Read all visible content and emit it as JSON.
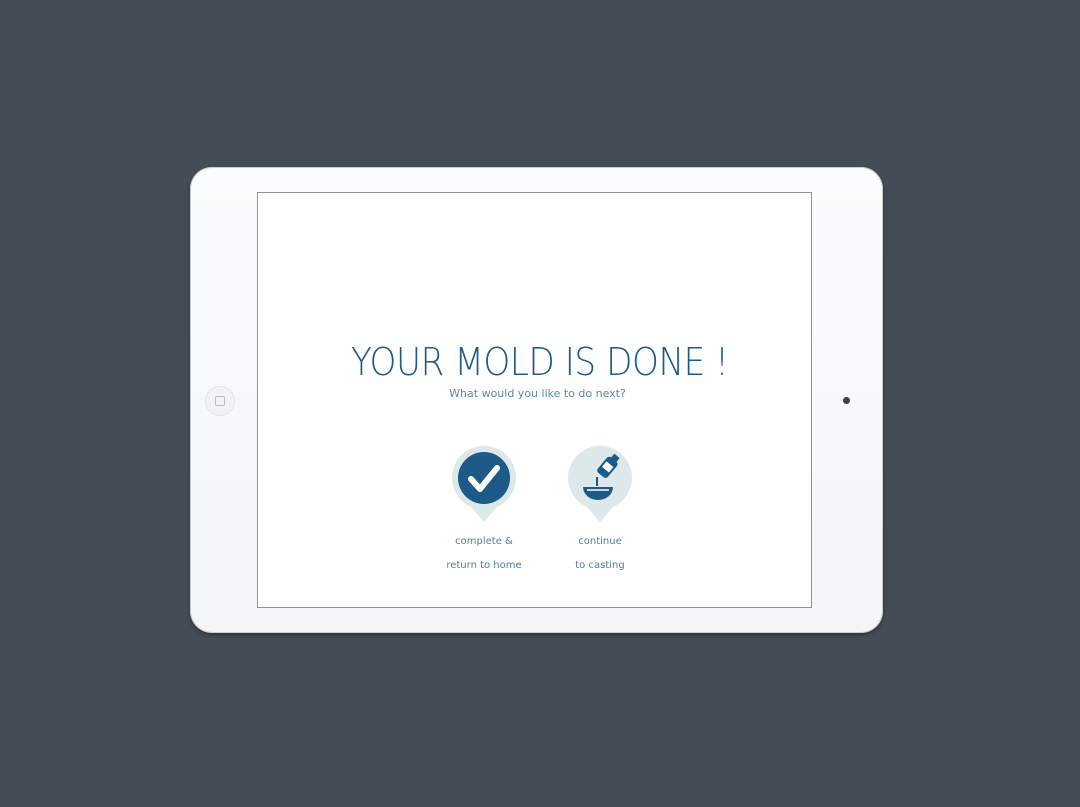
{
  "screen": {
    "title": "YOUR MOLD IS DONE !",
    "subtitle": "What would you like to do next?"
  },
  "actions": [
    {
      "icon": "checkmark-icon",
      "label_line1": "complete &",
      "label_line2": "return to home"
    },
    {
      "icon": "pour-bottle-bowl-icon",
      "label_line1": "continue",
      "label_line2": "to casting"
    }
  ],
  "colors": {
    "background": "#444d56",
    "accent": "#1d5a87",
    "pin_ring": "#dce8ea",
    "text_secondary": "#5a8aa8"
  }
}
